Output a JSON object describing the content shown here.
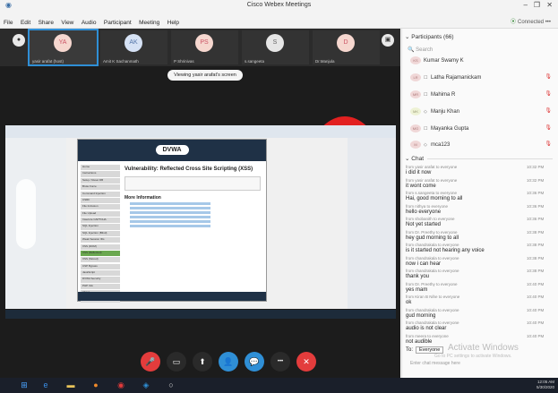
{
  "window": {
    "title": "Cisco Webex Meetings",
    "min": "–",
    "restore": "❐",
    "close": "✕"
  },
  "menu": [
    "File",
    "Edit",
    "Share",
    "View",
    "Audio",
    "Participant",
    "Meeting",
    "Help"
  ],
  "status": {
    "connected": "Connected",
    "more": "•••"
  },
  "thumbnails": [
    {
      "initials": "YA",
      "name": "yasir arafat (host)",
      "color": "#f6d7cf",
      "text": "#c56"
    },
    {
      "initials": "AK",
      "name": "Amit K Sachanmath",
      "color": "#d6e2f5",
      "text": "#57a"
    },
    {
      "initials": "PS",
      "name": "P Shrinivas",
      "color": "#f6d7cf",
      "text": "#c56"
    },
    {
      "initials": "S",
      "name": "s.sangeeta",
      "color": "#e6e6e6",
      "text": "#666"
    },
    {
      "initials": "D",
      "name": "Dr.Manjula",
      "color": "#f6d7cf",
      "text": "#c56"
    }
  ],
  "viewing_label": "Viewing yasir arafat's screen",
  "shared_screen": {
    "logo": "DVWA",
    "heading": "Vulnerability: Reflected Cross Site Scripting (XSS)",
    "more_info": "More Information",
    "menu_items": [
      "Home",
      "Instructions",
      "Setup / Reset DB",
      "Brute Force",
      "Command Injection",
      "CSRF",
      "File Inclusion",
      "File Upload",
      "Insecure CAPTCHA",
      "SQL Injection",
      "SQL Injection (Blind)",
      "Weak Session IDs",
      "XSS (DOM)",
      "XSS (Reflected)",
      "XSS (Stored)",
      "CSP Bypass",
      "JavaScript",
      "DVWA Security",
      "PHP Info",
      "About",
      "Logout"
    ]
  },
  "participants": {
    "header": "Participants (66)",
    "search": "Search",
    "items": [
      {
        "initials": "KS",
        "name": "Kumar Swamy K"
      },
      {
        "initials": "LR",
        "name": "Latha Rajamanickam"
      },
      {
        "initials": "MR",
        "name": "Mahima R"
      },
      {
        "initials": "MK",
        "name": "Manju Khan"
      },
      {
        "initials": "MG",
        "name": "Mayanka Gupta"
      },
      {
        "initials": "M",
        "name": "mca123"
      }
    ]
  },
  "chat": {
    "header": "Chat",
    "messages": [
      {
        "from": "from yasir arafat to everyone",
        "time": "10:32 PM",
        "text": "i did it now"
      },
      {
        "from": "from yasir arafat to everyone",
        "time": "10:32 PM",
        "text": "it wont come"
      },
      {
        "from": "from s.sangeeta to everyone",
        "time": "10:36 PM",
        "text": "Hai, good morning to all"
      },
      {
        "from": "from nithya to everyone",
        "time": "10:36 PM",
        "text": "hello everyone"
      },
      {
        "from": "from shobanith to everyone",
        "time": "10:36 PM",
        "text": "Not yet started"
      },
      {
        "from": "from Dr. Preethy to everyone",
        "time": "10:38 PM",
        "text": "hey gud morning to all"
      },
      {
        "from": "from chandrakala to everyone",
        "time": "10:38 PM",
        "text": "is it started not hearing any voice"
      },
      {
        "from": "from chandrakala to everyone",
        "time": "10:38 PM",
        "text": "now i can hear"
      },
      {
        "from": "from chandrakala to everyone",
        "time": "10:38 PM",
        "text": "thank you"
      },
      {
        "from": "from Dr. Preethy to everyone",
        "time": "10:40 PM",
        "text": "yes mam"
      },
      {
        "from": "from Kiran B Nihe to everyone",
        "time": "10:40 PM",
        "text": "ok"
      },
      {
        "from": "from chandrakala to everyone",
        "time": "10:40 PM",
        "text": "gud morning"
      },
      {
        "from": "from chandrakala to everyone",
        "time": "10:40 PM",
        "text": "audio is not clear"
      },
      {
        "from": "from meera to everyone",
        "time": "10:40 PM",
        "text": "not audible"
      }
    ],
    "to_label": "To:",
    "to_value": "Everyone",
    "input_placeholder": "Enter chat message here"
  },
  "watermark": {
    "line1": "Activate Windows",
    "line2": "Go to PC settings to activate Windows."
  },
  "controls": [
    {
      "name": "mute-button",
      "icon": "🎤",
      "color": "#e33c3c"
    },
    {
      "name": "video-button",
      "icon": "▭",
      "color": "#2a2a2a"
    },
    {
      "name": "share-button",
      "icon": "⬆",
      "color": "#2a2a2a"
    },
    {
      "name": "participants-button",
      "icon": "👤",
      "color": "#2f8fd6"
    },
    {
      "name": "chat-button",
      "icon": "💬",
      "color": "#2f8fd6"
    },
    {
      "name": "more-button",
      "icon": "•••",
      "color": "#2a2a2a"
    },
    {
      "name": "leave-button",
      "icon": "✕",
      "color": "#e33c3c"
    }
  ],
  "tray": {
    "time": "12:05 AM",
    "date": "5/30/2020"
  }
}
